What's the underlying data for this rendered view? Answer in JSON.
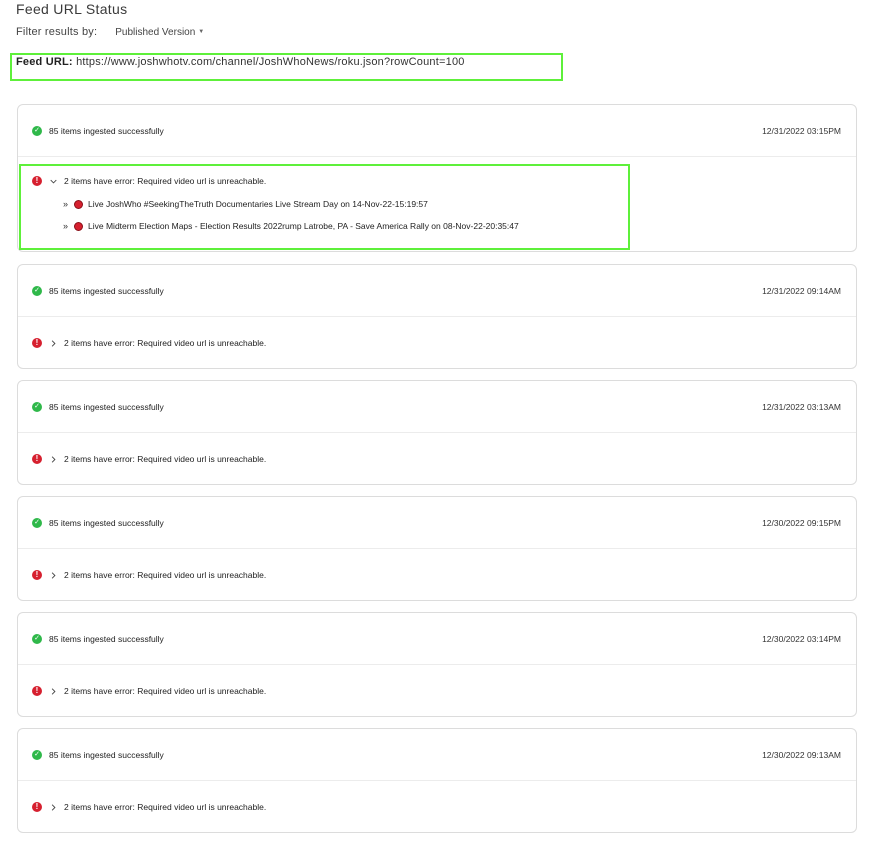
{
  "page": {
    "title": "Feed URL Status",
    "filter_label": "Filter results by:",
    "filter_value": "Published Version"
  },
  "feed": {
    "label": "Feed URL:",
    "url": "https://www.joshwhotv.com/channel/JoshWhoNews/roku.json?rowCount=100"
  },
  "colors": {
    "success": "#2fb84a",
    "error": "#d6202f",
    "highlight": "#5ef03a"
  },
  "icons": {
    "success": "check-circle-icon",
    "error": "exclamation-circle-icon",
    "expand": "chevron-icon",
    "item_status": "red-dot-icon"
  },
  "cards": [
    {
      "success_text": "85 items ingested successfully",
      "timestamp": "12/31/2022 03:15PM",
      "error_text": "2 items have error: Required video url is unreachable.",
      "expanded": true,
      "error_items": [
        "Live JoshWho #SeekingTheTruth Documentaries Live Stream Day on 14-Nov-22-15:19:57",
        "Live Midterm Election Maps - Election Results 2022rump Latrobe, PA - Save America Rally on 08-Nov-22-20:35:47"
      ]
    },
    {
      "success_text": "85 items ingested successfully",
      "timestamp": "12/31/2022 09:14AM",
      "error_text": "2 items have error: Required video url is unreachable.",
      "expanded": false
    },
    {
      "success_text": "85 items ingested successfully",
      "timestamp": "12/31/2022 03:13AM",
      "error_text": "2 items have error: Required video url is unreachable.",
      "expanded": false
    },
    {
      "success_text": "85 items ingested successfully",
      "timestamp": "12/30/2022 09:15PM",
      "error_text": "2 items have error: Required video url is unreachable.",
      "expanded": false
    },
    {
      "success_text": "85 items ingested successfully",
      "timestamp": "12/30/2022 03:14PM",
      "error_text": "2 items have error: Required video url is unreachable.",
      "expanded": false
    },
    {
      "success_text": "85 items ingested successfully",
      "timestamp": "12/30/2022 09:13AM",
      "error_text": "2 items have error: Required video url is unreachable.",
      "expanded": false
    }
  ]
}
